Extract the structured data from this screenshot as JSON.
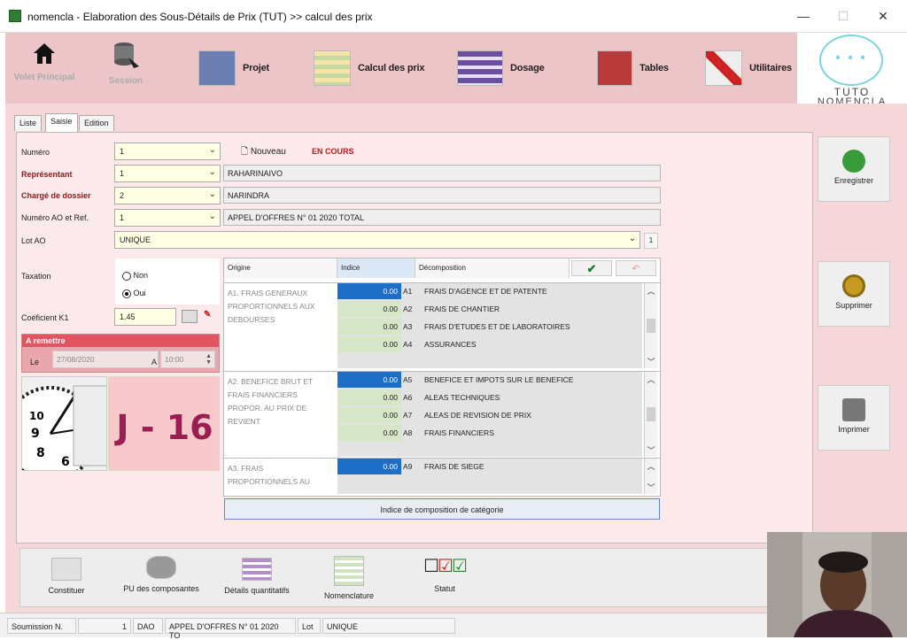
{
  "window": {
    "title": "nomencla - Elaboration des Sous-Détails de Prix (TUT) >> calcul des prix",
    "min": "—",
    "max": "☐",
    "close": "✕"
  },
  "toolbar": {
    "volet": "Volet Principal",
    "session": "Session",
    "projet": "Projet",
    "calcul": "Calcul des prix",
    "dosage": "Dosage",
    "tables": "Tables",
    "utilitaires": "Utilitaires"
  },
  "logo": {
    "dots": "• • •",
    "line1": "TUTO",
    "line2": "NOMENCLA"
  },
  "tabs": [
    "Liste",
    "Saisie",
    "Edition"
  ],
  "form": {
    "numero_label": "Numéro",
    "numero_value": "1",
    "nouveau_label": "Nouveau",
    "status": "EN COURS",
    "rep_label": "Représentant",
    "rep_value": "1",
    "rep_name": "RAHARINAIVO",
    "charge_label": "Chargé de dossier",
    "charge_value": "2",
    "charge_name": "NARINDRA",
    "ao_label": "Numéro AO et Ref.",
    "ao_value": "1",
    "ao_name": "APPEL D'OFFRES N° 01 2020 TOTAL",
    "lot_label": "Lot AO",
    "lot_value": "UNIQUE",
    "lot_num": "1",
    "taxation_label": "Taxation",
    "tax_non": "Non",
    "tax_oui": "Oui",
    "coef_label": "Coéficient K1",
    "coef_value": "1.45",
    "remettre_title": "A remettre",
    "le_label": "Le",
    "date_value": "27/08/2020",
    "a_label": "A",
    "time_value": "10:00",
    "countdown": "J - 16"
  },
  "grid": {
    "headers": [
      "Origine",
      "Indice",
      "Décomposition"
    ],
    "sections": [
      {
        "desc": "A1. FRAIS GENERAUX PROPORTIONNELS AUX DEBOURSES",
        "rows": [
          {
            "val": "0.00",
            "code": "A1",
            "name": "FRAIS D'AGENCE ET DE PATENTE"
          },
          {
            "val": "0.00",
            "code": "A2",
            "name": "FRAIS DE CHANTIER"
          },
          {
            "val": "0.00",
            "code": "A3",
            "name": "FRAIS D'ETUDES ET DE LABORATOIRES"
          },
          {
            "val": "0.00",
            "code": "A4",
            "name": "ASSURANCES"
          }
        ]
      },
      {
        "desc": "A2. BENEFICE BRUT ET FRAIS FINANCIERS PROPOR. AU PRIX DE REVIENT",
        "rows": [
          {
            "val": "0.00",
            "code": "A5",
            "name": "BENEFICE ET IMPOTS SUR LE BENEFICE"
          },
          {
            "val": "0.00",
            "code": "A6",
            "name": "ALEAS TECHNIQUES"
          },
          {
            "val": "0.00",
            "code": "A7",
            "name": "ALEAS DE REVISION DE PRIX"
          },
          {
            "val": "0.00",
            "code": "A8",
            "name": "FRAIS FINANCIERS"
          }
        ]
      },
      {
        "desc": "A3. FRAIS PROPORTIONNELS AU",
        "rows": [
          {
            "val": "0.00",
            "code": "A9",
            "name": "FRAIS DE SIEGE"
          }
        ]
      }
    ],
    "index_button": "Indice de composition de catégorie"
  },
  "right": {
    "save": "Enregistrer",
    "delete": "Supprimer",
    "print": "Imprimer"
  },
  "bottom": {
    "constituer": "Constituer",
    "pu": "PU des composantes",
    "details": "Détails quantitatifs",
    "nomenclature": "Nomenclature",
    "statut": "Statut"
  },
  "statusbar": {
    "soumission": "Soumission N.",
    "num": "1",
    "dao": "DAO",
    "ao": "APPEL D'OFFRES N° 01 2020 TO",
    "lot": "Lot",
    "lotval": "UNIQUE"
  }
}
